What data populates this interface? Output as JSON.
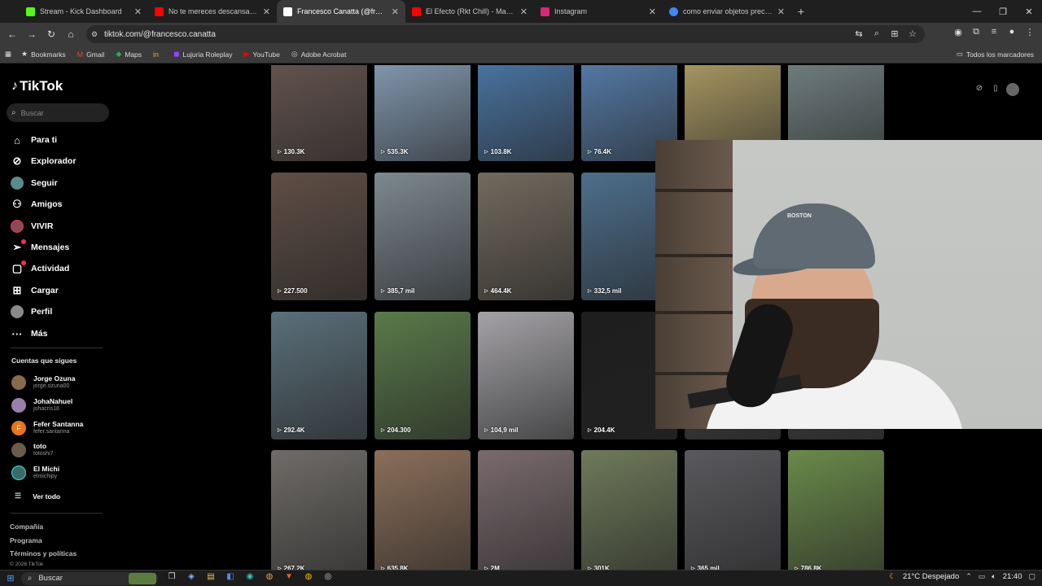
{
  "browser": {
    "tabs": [
      {
        "title": "Stream - Kick Dashboard",
        "favicon_color": "#53fc18"
      },
      {
        "title": "No te mereces descansar, pon",
        "favicon_color": "#ff0000"
      },
      {
        "title": "Francesco Canatta (@francesco",
        "favicon_color": "#ffffff",
        "active": true
      },
      {
        "title": "El Efecto (Rkt Chill) - Manu DJ",
        "favicon_color": "#ff0000"
      },
      {
        "title": "Instagram",
        "favicon_color": "#d62976"
      },
      {
        "title": "como enviar objetos preciados",
        "favicon_color": "#4285f4"
      }
    ],
    "new_tab": "+",
    "url": "tiktok.com/@francesco.canatta",
    "bookmarks": [
      {
        "label": "Bookmarks",
        "icon": "star-icon"
      },
      {
        "label": "Gmail",
        "icon": "gmail-icon"
      },
      {
        "label": "Maps",
        "icon": "maps-icon"
      },
      {
        "label": "",
        "icon": "in-icon"
      },
      {
        "label": "Lujuria Roleplay",
        "icon": "twitch-icon"
      },
      {
        "label": "YouTube",
        "icon": "youtube-icon"
      },
      {
        "label": "Adobe Acrobat",
        "icon": "acrobat-icon"
      }
    ],
    "all_bookmarks": "Todos los marcadores"
  },
  "tiktok": {
    "logo": "TikTok",
    "search_placeholder": "Buscar",
    "nav": [
      {
        "label": "Para ti",
        "icon": "home-icon"
      },
      {
        "label": "Explorador",
        "icon": "compass-icon"
      },
      {
        "label": "Seguir",
        "icon": "following-avatar-icon"
      },
      {
        "label": "Amigos",
        "icon": "friends-icon"
      },
      {
        "label": "VIVIR",
        "icon": "live-icon"
      },
      {
        "label": "Mensajes",
        "icon": "send-icon"
      },
      {
        "label": "Actividad",
        "icon": "activity-icon"
      },
      {
        "label": "Cargar",
        "icon": "upload-icon"
      },
      {
        "label": "Perfil",
        "icon": "profile-avatar-icon"
      },
      {
        "label": "Más",
        "icon": "more-icon"
      }
    ],
    "following_title": "Cuentas que sigues",
    "following": [
      {
        "name": "Jorge Ozuna",
        "handle": "jorge.ozuna00",
        "color": "#8a6a4a"
      },
      {
        "name": "JohaNahuel",
        "handle": "johacris18",
        "color": "#9a7fa8"
      },
      {
        "name": "Fefer Santanna",
        "handle": "fefer.santanna",
        "color": "#e8741c",
        "initial": "F"
      },
      {
        "name": "toto",
        "handle": "totoshi7",
        "color": "#6b5b4b"
      },
      {
        "name": "El Michi",
        "handle": "elmichipy",
        "color": "#3a6b6b"
      }
    ],
    "see_all": "Ver todo",
    "footer": [
      "Compañía",
      "Programa",
      "Términos y políticas"
    ],
    "copyright": "© 2026 TikTok",
    "videos": [
      {
        "views": "130.3K",
        "bg": "#6d5a55"
      },
      {
        "views": "535.3K",
        "bg": "#8fa8c2"
      },
      {
        "views": "103.8K",
        "bg": "#4f7fb3"
      },
      {
        "views": "76.4K",
        "bg": "#5b86b8"
      },
      {
        "views": "",
        "bg": "#b9a76a"
      },
      {
        "views": "",
        "bg": "#7a8a8c"
      },
      {
        "views": "227.500",
        "bg": "#5f4e45"
      },
      {
        "views": "385,7 mil",
        "bg": "#7d8890"
      },
      {
        "views": "464.4K",
        "bg": "#726a5e"
      },
      {
        "views": "332,5 mil",
        "bg": "#4d6f8c"
      },
      {
        "views": "",
        "bg": "#555"
      },
      {
        "views": "",
        "bg": "#555"
      },
      {
        "views": "292.4K",
        "bg": "#5b6f7a"
      },
      {
        "views": "204.300",
        "bg": "#5a7a4a"
      },
      {
        "views": "104,9 mil",
        "bg": "#a4a2a6"
      },
      {
        "views": "204.4K",
        "bg": "#1e1e1e"
      },
      {
        "views": "",
        "bg": "#444"
      },
      {
        "views": "",
        "bg": "#444"
      },
      {
        "views": "267.2K",
        "bg": "#6f6c68"
      },
      {
        "views": "635.8K",
        "bg": "#8b6f5a"
      },
      {
        "views": "2M",
        "bg": "#7a6a6e"
      },
      {
        "views": "301K",
        "bg": "#6f7a5a"
      },
      {
        "views": "365 mil",
        "bg": "#5a5a5e"
      },
      {
        "views": "786.8K",
        "bg": "#6a8a4a"
      }
    ]
  },
  "webcam": {
    "cap_text": "BOSTON"
  },
  "taskbar": {
    "search": "Buscar",
    "weather": "21°C Despejado",
    "time": "21:40"
  }
}
